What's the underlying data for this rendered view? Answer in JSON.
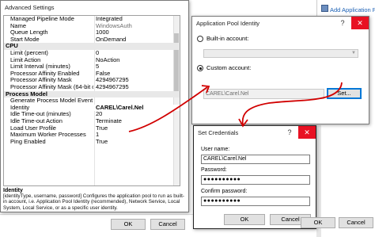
{
  "background": {
    "link_text": "Add Application Pool",
    "colors": {
      "annotation_red": "#d10000",
      "accent_blue": "#0078d7",
      "link_blue": "#1a5fb4"
    }
  },
  "advanced_settings": {
    "title": "Advanced Settings",
    "rows": [
      {
        "name": "Managed Pipeline Mode",
        "value": "Integrated",
        "kind": "prop"
      },
      {
        "name": "Name",
        "value": "WindowsAuth",
        "kind": "grey"
      },
      {
        "name": "Queue Length",
        "value": "1000",
        "kind": "prop"
      },
      {
        "name": "Start Mode",
        "value": "OnDemand",
        "kind": "prop"
      },
      {
        "name": "CPU",
        "value": "",
        "kind": "cat"
      },
      {
        "name": "Limit (percent)",
        "value": "0",
        "kind": "prop"
      },
      {
        "name": "Limit Action",
        "value": "NoAction",
        "kind": "prop"
      },
      {
        "name": "Limit Interval (minutes)",
        "value": "5",
        "kind": "prop"
      },
      {
        "name": "Processor Affinity Enabled",
        "value": "False",
        "kind": "prop"
      },
      {
        "name": "Processor Affinity Mask",
        "value": "4294967295",
        "kind": "prop"
      },
      {
        "name": "Processor Affinity Mask (64-bit op",
        "value": "4294967295",
        "kind": "prop"
      },
      {
        "name": "Process Model",
        "value": "",
        "kind": "cat"
      },
      {
        "name": "Generate Process Model Event L",
        "value": "",
        "kind": "prop"
      },
      {
        "name": "Identity",
        "value": "CAREL\\Carel.Nel",
        "kind": "sel"
      },
      {
        "name": "Idle Time-out (minutes)",
        "value": "20",
        "kind": "prop"
      },
      {
        "name": "Idle Time-out Action",
        "value": "Terminate",
        "kind": "prop"
      },
      {
        "name": "Load User Profile",
        "value": "True",
        "kind": "prop"
      },
      {
        "name": "Maximum Worker Processes",
        "value": "1",
        "kind": "prop"
      },
      {
        "name": "Ping Enabled",
        "value": "True",
        "kind": "prop"
      }
    ],
    "description_title": "Identity",
    "description_text": "[identityType, username, password] Configures the application pool to run as built-in account, i.e. Application Pool Identity (recommended), Network Service, Local System, Local Service, or as a specific user identity.",
    "ok_label": "OK",
    "cancel_label": "Cancel"
  },
  "app_pool_identity": {
    "title": "Application Pool Identity",
    "help_glyph": "?",
    "close_glyph": "✕",
    "builtin_label": "Built-in account:",
    "builtin_selected": false,
    "custom_label": "Custom account:",
    "custom_selected": true,
    "custom_value": "CAREL\\Carel.Nel",
    "set_label": "Set...",
    "ok_label": "OK",
    "cancel_label": "Cancel"
  },
  "set_credentials": {
    "title": "Set Credentials",
    "help_glyph": "?",
    "close_glyph": "✕",
    "username_label": "User name:",
    "username_value": "CAREL\\Carel.Nel",
    "password_label": "Password:",
    "password_value": "●●●●●●●●●●",
    "confirm_label": "Confirm password:",
    "confirm_value": "●●●●●●●●●●",
    "ok_label": "OK",
    "cancel_label": "Cancel"
  }
}
